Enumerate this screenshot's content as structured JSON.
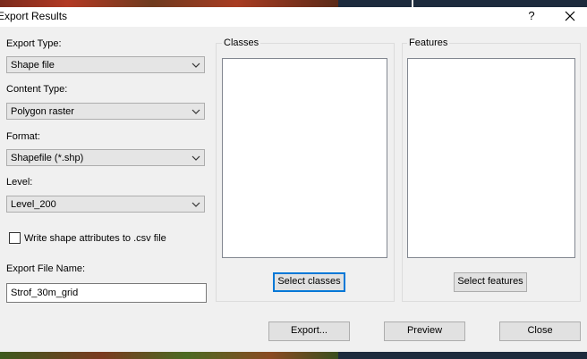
{
  "dialog": {
    "title": "Export Results",
    "help_label": "?"
  },
  "fields": {
    "export_type": {
      "label": "Export Type:",
      "value": "Shape file"
    },
    "content_type": {
      "label": "Content Type:",
      "value": "Polygon raster"
    },
    "format": {
      "label": "Format:",
      "value": "Shapefile (*.shp)"
    },
    "level": {
      "label": "Level:",
      "value": "Level_200"
    },
    "write_attributes": {
      "label": "Write shape attributes to .csv file",
      "checked": false
    },
    "file_name": {
      "label": "Export File Name:",
      "value": "Strof_30m_grid"
    }
  },
  "classes": {
    "label": "Classes",
    "button": "Select classes",
    "items": []
  },
  "features": {
    "label": "Features",
    "button": "Select features",
    "items": []
  },
  "footer": {
    "export": "Export...",
    "preview": "Preview",
    "close": "Close"
  },
  "colors": {
    "focus": "#0078d7",
    "dialog_bg": "#f0f0f0"
  }
}
